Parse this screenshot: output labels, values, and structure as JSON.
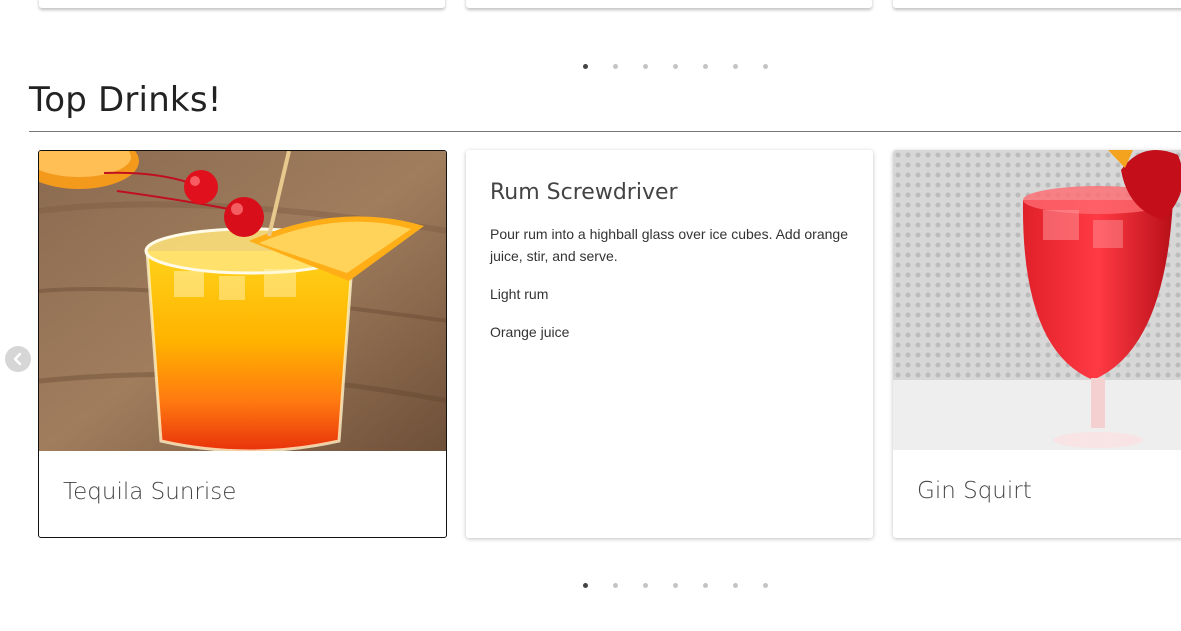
{
  "section": {
    "title": "Top Drinks!"
  },
  "top_carousel": {
    "dots": 7,
    "active_index": 0
  },
  "bottom_carousel": {
    "dots": 7,
    "active_index": 0
  },
  "cards": [
    {
      "name": "Tequila Sunrise"
    },
    {
      "name": "Rum Screwdriver",
      "instructions": "Pour rum into a highball glass over ice cubes. Add orange juice, stir, and serve.",
      "ingredients": [
        "Light rum",
        "Orange juice"
      ]
    },
    {
      "name": "Gin Squirt"
    }
  ],
  "icons": {
    "prev": "chevron-left-icon"
  },
  "colors": {
    "dot_active": "#444444",
    "dot_inactive": "#c4c4c4",
    "nav_button": "#d6d6d6"
  }
}
